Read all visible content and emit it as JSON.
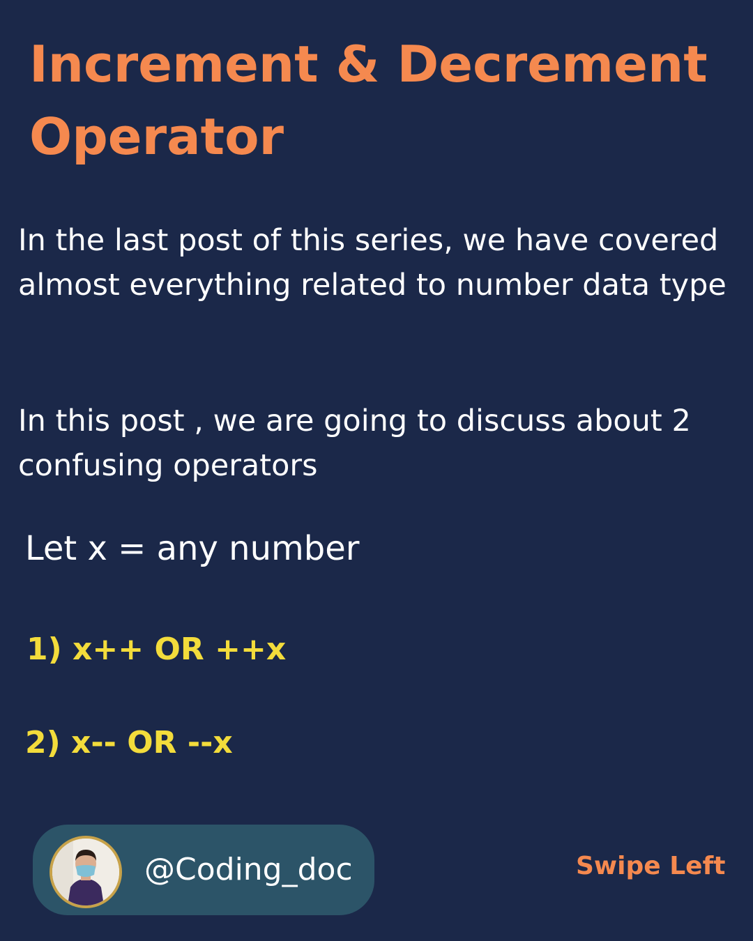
{
  "title": "Increment & Decrement Operator",
  "paragraphs": {
    "intro": "In the last post of this series, we have covered almost everything related to number data type",
    "topic": "In this post , we are going to discuss about 2 confusing operators"
  },
  "let_statement": "Let x = any number",
  "operators": [
    "1) x++ OR ++x",
    "2) x-- OR --x"
  ],
  "profile": {
    "handle": "@Coding_doc",
    "avatar_icon": "profile-photo"
  },
  "swipe_label": "Swipe Left",
  "colors": {
    "background": "#1b2849",
    "title": "#f5894f",
    "operators": "#f3dc3b",
    "profile_pill": "#2c5468",
    "avatar_ring": "#c7a24a"
  }
}
